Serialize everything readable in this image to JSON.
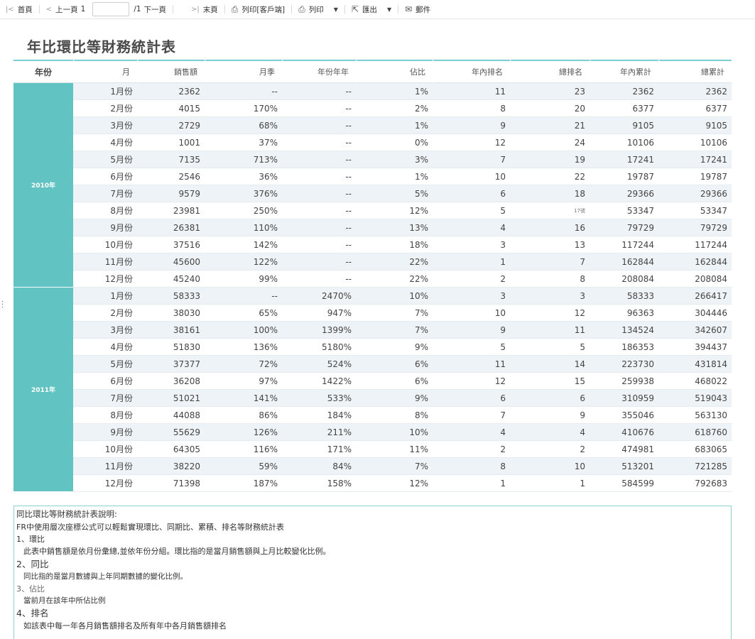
{
  "toolbar": {
    "first": "首頁",
    "prev": "上一頁",
    "page_num": "1",
    "page_total": "/1",
    "next": "下一頁",
    "last": "末頁",
    "print_client": "列印[客戶端]",
    "print": "列印",
    "export": "匯出",
    "mail": "郵件"
  },
  "report": {
    "title": "年比環比等財務統計表",
    "headers": [
      "年份",
      "月",
      "銷售額",
      "月季",
      "年份年年",
      "佔比",
      "年內排名",
      "總排名",
      "年內累計",
      "總累計"
    ],
    "years": [
      {
        "label": "2010年",
        "rows": [
          [
            "1月份",
            "2362",
            "--",
            "--",
            "1%",
            "11",
            "23",
            "2362",
            "2362"
          ],
          [
            "2月份",
            "4015",
            "170%",
            "--",
            "2%",
            "8",
            "20",
            "6377",
            "6377"
          ],
          [
            "3月份",
            "2729",
            "68%",
            "--",
            "1%",
            "9",
            "21",
            "9105",
            "9105"
          ],
          [
            "4月份",
            "1001",
            "37%",
            "--",
            "0%",
            "12",
            "24",
            "10106",
            "10106"
          ],
          [
            "5月份",
            "7135",
            "713%",
            "--",
            "3%",
            "7",
            "19",
            "17241",
            "17241"
          ],
          [
            "6月份",
            "2546",
            "36%",
            "--",
            "1%",
            "10",
            "22",
            "19787",
            "19787"
          ],
          [
            "7月份",
            "9579",
            "376%",
            "--",
            "5%",
            "6",
            "18",
            "29366",
            "29366"
          ],
          [
            "8月份",
            "23981",
            "250%",
            "--",
            "12%",
            "5",
            "17號",
            "53347",
            "53347"
          ],
          [
            "9月份",
            "26381",
            "110%",
            "--",
            "13%",
            "4",
            "16",
            "79729",
            "79729"
          ],
          [
            "10月份",
            "37516",
            "142%",
            "--",
            "18%",
            "3",
            "13",
            "117244",
            "117244"
          ],
          [
            "11月份",
            "45600",
            "122%",
            "--",
            "22%",
            "1",
            "7",
            "162844",
            "162844"
          ],
          [
            "12月份",
            "45240",
            "99%",
            "--",
            "22%",
            "2",
            "8",
            "208084",
            "208084"
          ]
        ]
      },
      {
        "label": "2011年",
        "rows": [
          [
            "1月份",
            "58333",
            "--",
            "2470%",
            "10%",
            "3",
            "3",
            "58333",
            "266417"
          ],
          [
            "2月份",
            "38030",
            "65%",
            "947%",
            "7%",
            "10",
            "12",
            "96363",
            "304446"
          ],
          [
            "3月份",
            "38161",
            "100%",
            "1399%",
            "7%",
            "9",
            "11",
            "134524",
            "342607"
          ],
          [
            "4月份",
            "51830",
            "136%",
            "5180%",
            "9%",
            "5",
            "5",
            "186353",
            "394437"
          ],
          [
            "5月份",
            "37377",
            "72%",
            "524%",
            "6%",
            "11",
            "14",
            "223730",
            "431814"
          ],
          [
            "6月份",
            "36208",
            "97%",
            "1422%",
            "6%",
            "12",
            "15",
            "259938",
            "468022"
          ],
          [
            "7月份",
            "51021",
            "141%",
            "533%",
            "9%",
            "6",
            "6",
            "310959",
            "519043"
          ],
          [
            "8月份",
            "44088",
            "86%",
            "184%",
            "8%",
            "7",
            "9",
            "355046",
            "563130"
          ],
          [
            "9月份",
            "55629",
            "126%",
            "211%",
            "10%",
            "4",
            "4",
            "410676",
            "618760"
          ],
          [
            "10月份",
            "64305",
            "116%",
            "171%",
            "11%",
            "2",
            "2",
            "474981",
            "683065"
          ],
          [
            "11月份",
            "38220",
            "59%",
            "84%",
            "7%",
            "8",
            "10",
            "513201",
            "721285"
          ],
          [
            "12月份",
            "71398",
            "187%",
            "158%",
            "12%",
            "1",
            "1",
            "584599",
            "792683"
          ]
        ]
      }
    ]
  },
  "notes": {
    "title": "同比環比等財務統計表說明:",
    "intro": "FR中使用層次座標公式可以輕鬆實現環比、同期比、累積、排名等財務統計表",
    "s1_title": "1、環比",
    "s1_text": "此表中銷售額是依月份彙總,並依年份分組。環比指的是當月銷售額與上月比較變化比例。",
    "s2_title": "2、同比",
    "s2_text": "同比指的是當月數據與上年同期數據的變化比例。",
    "s3_title": "3、佔比",
    "s3_text": "當前月在該年中所佔比例",
    "s4_title": "4、排名",
    "s4_text": "如該表中每一年各月銷售額排名及所有年中各月銷售額排名"
  }
}
